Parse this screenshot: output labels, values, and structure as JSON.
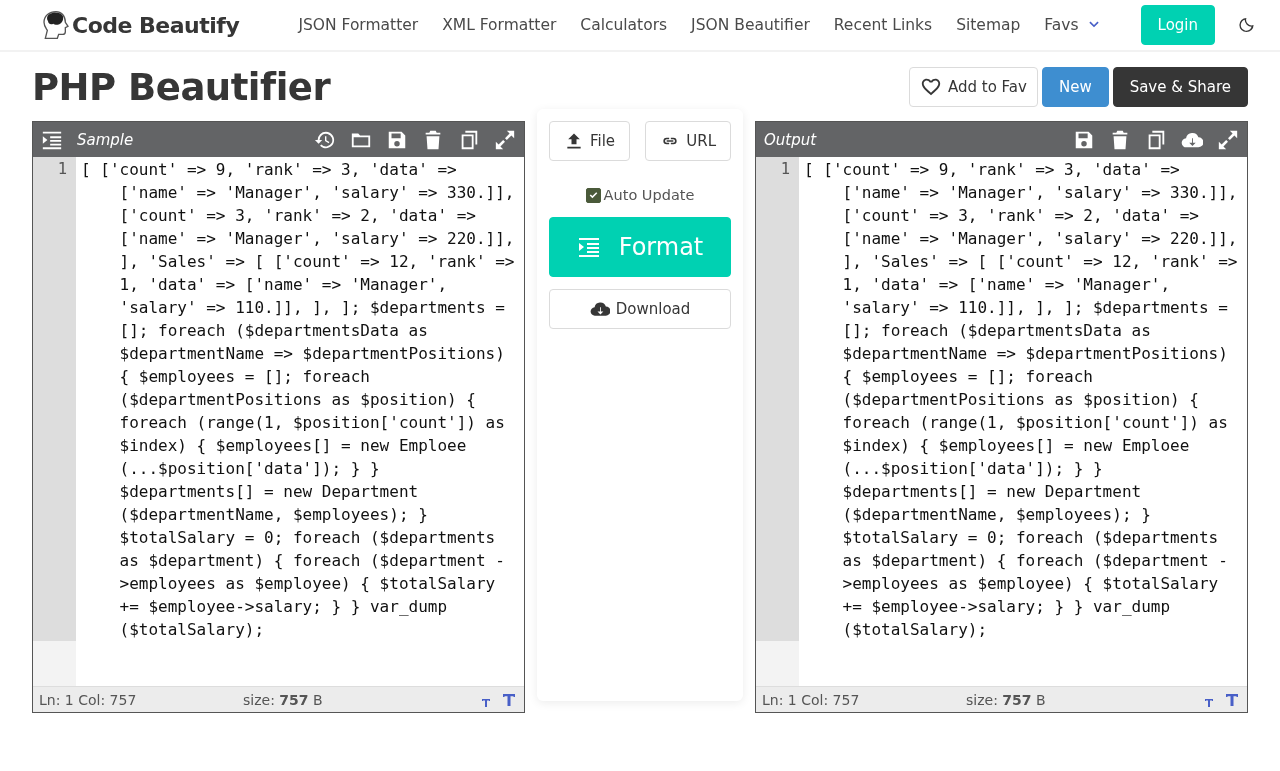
{
  "header": {
    "logo": "Code Beautify",
    "nav": [
      {
        "label": "JSON Formatter",
        "kind": "link"
      },
      {
        "label": "XML Formatter",
        "kind": "link"
      },
      {
        "label": "Calculators",
        "kind": "link"
      },
      {
        "label": "JSON Beautifier",
        "kind": "link"
      },
      {
        "label": "Recent Links",
        "kind": "link"
      },
      {
        "label": "Sitemap",
        "kind": "link"
      },
      {
        "label": "Favs",
        "kind": "dropdown"
      }
    ],
    "login": "Login"
  },
  "page_title": "PHP Beautifier",
  "actions": [
    {
      "label": "Add to Fav",
      "kind": "fav"
    },
    {
      "label": "New",
      "kind": "primary"
    },
    {
      "label": "Save & Share",
      "kind": "dark"
    }
  ],
  "editors": [
    {
      "title": "Sample",
      "line_numbers": [
        "1"
      ],
      "code": "[ ['count' => 9, 'rank' => 3, 'data' => ['name' => 'Manager', 'salary' => 330.]], ['count' => 3, 'rank' => 2, 'data' => ['name' => 'Manager', 'salary' => 220.]], ], 'Sales' => [ ['count' => 12, 'rank' => 1, 'data' => ['name' => 'Manager', 'salary' => 110.]], ], ]; $departments = []; foreach ($departmentsData as $departmentName => $departmentPositions) { $employees = []; foreach ($departmentPositions as $position) { foreach (range(1, $position['count']) as $index) { $employees[] = new Emploee (...$position['data']); } } $departments[] = new Department ($departmentName, $employees); } $totalSalary = 0; foreach ($departments as $department) { foreach ($department ->employees as $employee) { $totalSalary += $employee->salary; } } var_dump ($totalSalary);",
      "status": {
        "position": "Ln: 1 Col: 757",
        "size_label": "size:",
        "size_value": "757",
        "size_unit": "B"
      }
    },
    {
      "title": "Output",
      "line_numbers": [
        "1"
      ],
      "code": "[ ['count' => 9, 'rank' => 3, 'data' => ['name' => 'Manager', 'salary' => 330.]], ['count' => 3, 'rank' => 2, 'data' => ['name' => 'Manager', 'salary' => 220.]], ], 'Sales' => [ ['count' => 12, 'rank' => 1, 'data' => ['name' => 'Manager', 'salary' => 110.]], ], ]; $departments = []; foreach ($departmentsData as $departmentName => $departmentPositions) { $employees = []; foreach ($departmentPositions as $position) { foreach (range(1, $position['count']) as $index) { $employees[] = new Emploee (...$position['data']); } } $departments[] = new Department ($departmentName, $employees); } $totalSalary = 0; foreach ($departments as $department) { foreach ($department ->employees as $employee) { $totalSalary += $employee->salary; } } var_dump ($totalSalary);",
      "status": {
        "position": "Ln: 1 Col: 757",
        "size_label": "size:",
        "size_value": "757",
        "size_unit": "B"
      }
    }
  ],
  "middle": {
    "file_button": "File",
    "url_button": "URL",
    "auto_update": {
      "label": "Auto Update",
      "checked": true
    },
    "format_button": "Format",
    "download_button": "Download"
  }
}
